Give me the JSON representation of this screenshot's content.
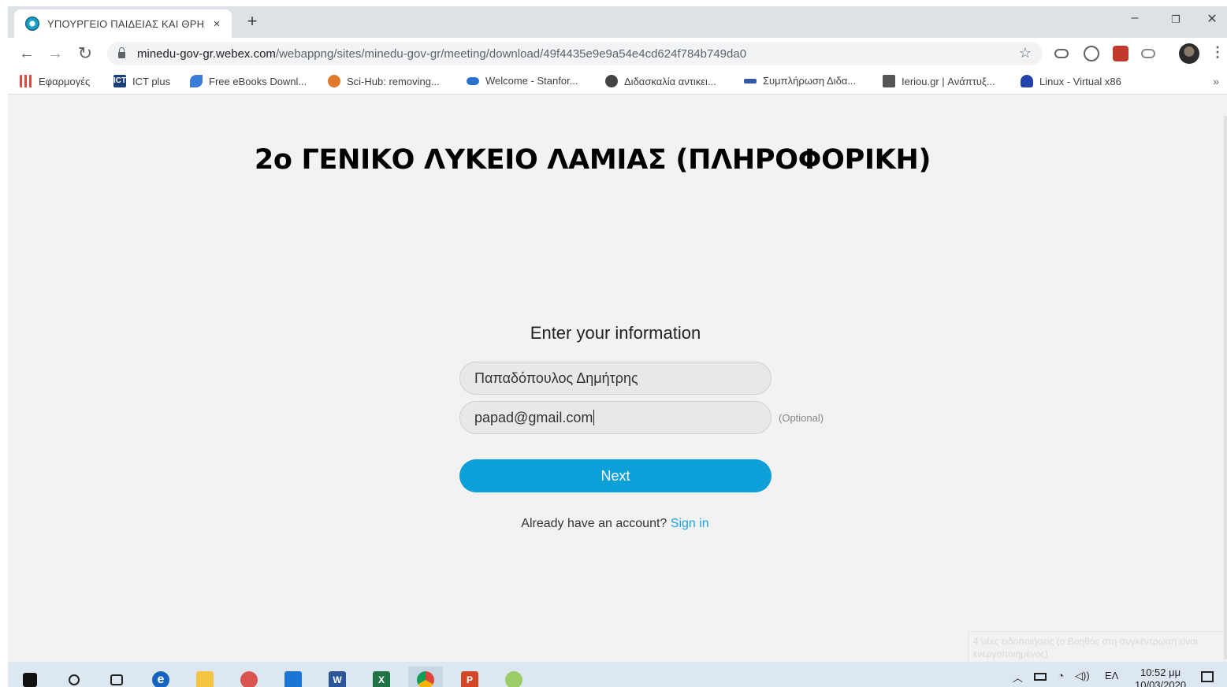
{
  "browser": {
    "tab_title": "ΥΠΟΥΡΓΕΙΟ ΠΑΙΔΕΙΑΣ ΚΑΙ ΘΡΗΣ",
    "tab_close": "×",
    "new_tab": "+",
    "window_controls": {
      "minimize": "–",
      "restore": "❐",
      "close": "✕"
    },
    "url_host": "minedu-gov-gr.webex.com",
    "url_path": "/webappng/sites/minedu-gov-gr/meeting/download/49f4435e9e9a54e4cd624f784b749da0",
    "nav": {
      "back": "←",
      "forward": "→",
      "reload": "↻"
    },
    "star": "☆",
    "menu": "⋮"
  },
  "bookmarks": [
    {
      "label": "Εφαρμογές",
      "icon": "apps-grid-icon",
      "color": "#e8453c"
    },
    {
      "label": "ICT plus",
      "icon": "ict-icon",
      "color": "#1a3f7a"
    },
    {
      "label": "Free eBooks Downl...",
      "icon": "ebooks-icon",
      "color": "#3b7dd8"
    },
    {
      "label": "Sci-Hub: removing...",
      "icon": "scihub-icon",
      "color": "#e0792b"
    },
    {
      "label": "Welcome - Stanfor...",
      "icon": "coursera-icon",
      "color": "#2a73cc"
    },
    {
      "label": "Διδασκαλία αντικει...",
      "icon": "globe-icon",
      "color": "#444444"
    },
    {
      "label": "Συμπλήρωση Διδα...",
      "icon": "form-icon",
      "color": "#3355aa"
    },
    {
      "label": "Ieriou.gr | Ανάπτυξ...",
      "icon": "ieriou-icon",
      "color": "#555555"
    },
    {
      "label": "Linux - Virtual x86",
      "icon": "linux-icon",
      "color": "#2244aa"
    }
  ],
  "bookmarks_more": "»",
  "page": {
    "heading": "2ο ΓΕΝΙΚΟ ΛΥΚΕΙΟ ΛΑΜΙΑΣ  (ΠΛΗΡΟΦΟΡΙΚΗ)",
    "form_title": "Enter your information",
    "name_value": "Παπαδόπουλος Δημήτρης",
    "email_value": "papad@gmail.com",
    "optional_label": "(Optional)",
    "next_label": "Next",
    "signin_prompt": "Already have an account?",
    "signin_link": "Sign in",
    "accent_color": "#0d9fd8"
  },
  "notification": {
    "text": "4 νέες ειδοποιήσεις (ο Βοηθός στη συγκέντρωση είναι ενεργοποιημένος)"
  },
  "taskbar": {
    "lang": "ΕΛ",
    "time": "10:52 μμ",
    "date": "10/03/2020"
  }
}
